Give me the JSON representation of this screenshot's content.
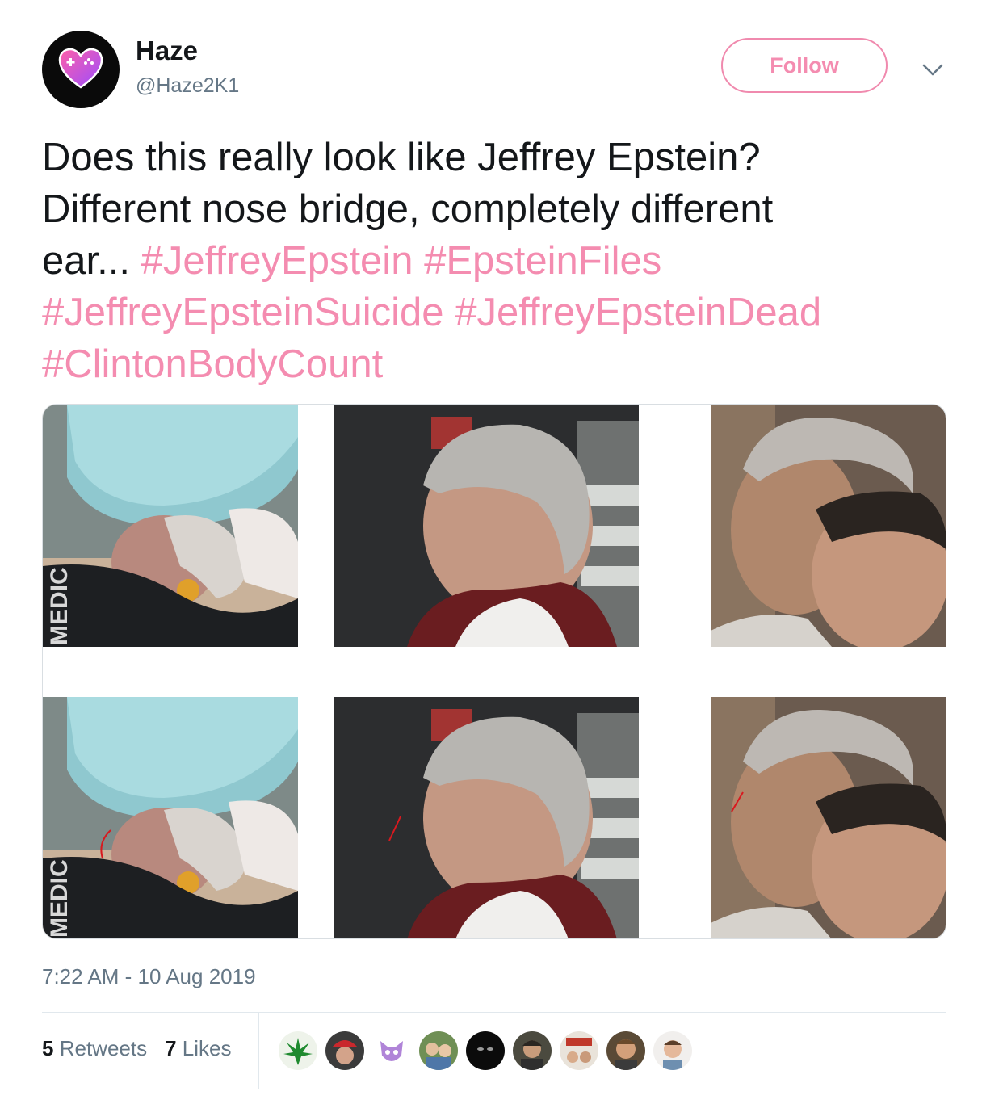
{
  "user": {
    "display_name": "Haze",
    "handle": "@Haze2K1",
    "avatar_icon": "heart-gamepad-icon"
  },
  "follow_label": "Follow",
  "tweet": {
    "line1": "Does this really look like Jeffrey Epstein?",
    "line2": "Different nose bridge, completely different",
    "line3_text": "ear...",
    "hashtags": [
      "#JeffreyEpstein",
      "#EpsteinFiles",
      "#JeffreyEpsteinSuicide",
      "#JeffreyEpsteinDead",
      "#ClintonBodyCount"
    ]
  },
  "media": {
    "medic_label": "MEDIC"
  },
  "timestamp": "7:22 AM - 10 Aug 2019",
  "stats": {
    "retweets_count": "5",
    "retweets_label": "Retweets",
    "likes_count": "7",
    "likes_label": "Likes"
  },
  "colors": {
    "accent": "#f48cb0",
    "text": "#14171a",
    "muted": "#657786"
  }
}
